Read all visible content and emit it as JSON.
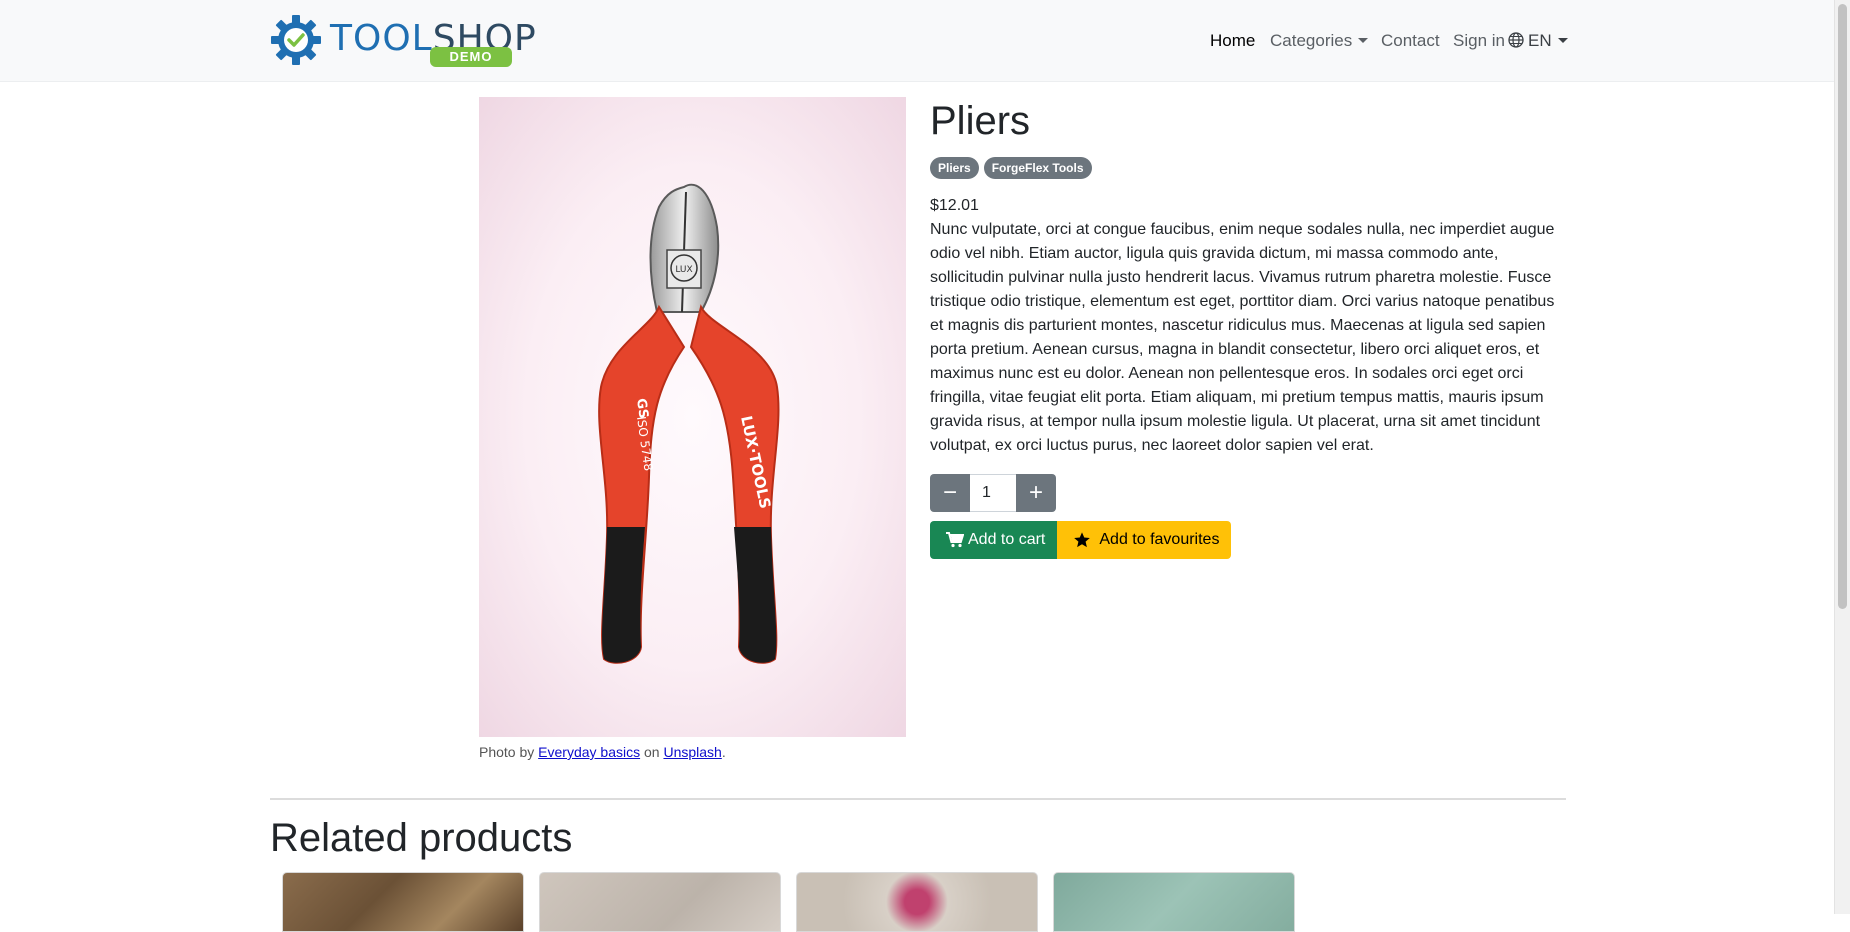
{
  "brand": {
    "name_part1": "TOOL",
    "name_part2": "SHOP",
    "tag": "DEMO"
  },
  "nav": {
    "home": "Home",
    "categories": "Categories",
    "contact": "Contact",
    "signin": "Sign in",
    "language": "EN"
  },
  "product": {
    "title": "Pliers",
    "badges": [
      "Pliers",
      "ForgeFlex Tools"
    ],
    "price": "$12.01",
    "description": "Nunc vulputate, orci at congue faucibus, enim neque sodales nulla, nec imperdiet augue odio vel nibh. Etiam auctor, ligula quis gravida dictum, mi massa commodo ante, sollicitudin pulvinar nulla justo hendrerit lacus. Vivamus rutrum pharetra molestie. Fusce tristique odio tristique, elementum est eget, porttitor diam. Orci varius natoque penatibus et magnis dis parturient montes, nascetur ridiculus mus. Maecenas at ligula sed sapien porta pretium. Aenean cursus, magna in blandit consectetur, libero orci aliquet eros, et maximus nunc est eu dolor. Aenean non pellentesque eros. In sodales orci eget orci fringilla, vitae feugiat elit porta. Etiam aliquam, mi pretium tempus mattis, mauris ipsum gravida risus, at tempor nulla ipsum molestie ligula. Ut placerat, urna sit amet tincidunt volutpat, ex orci luctus purus, nec laoreet dolor sapien vel erat.",
    "quantity": "1",
    "minus_symbol": "−",
    "plus_symbol": "+",
    "add_to_cart": "Add to cart",
    "add_to_favourites": "Add to favourites",
    "image_print": {
      "brand": "LUX·TOOLS",
      "iso": "ISO 5748",
      "gs": "GS"
    }
  },
  "credit": {
    "prefix": "Photo by",
    "author": "Everyday basics",
    "middle": "on",
    "site": "Unsplash",
    "suffix": "."
  },
  "related": {
    "heading": "Related products"
  },
  "icons": {
    "logo": "gear-check-logo-icon",
    "globe": "globe-icon",
    "cart": "cart-icon",
    "star": "star-icon"
  },
  "colors": {
    "navbar_bg": "#f8f9fa",
    "badge": "#6c757d",
    "cart_button": "#198754",
    "fav_button": "#ffc107",
    "demo_tag": "#7cc142",
    "logo_blue": "#1f6fb2"
  }
}
